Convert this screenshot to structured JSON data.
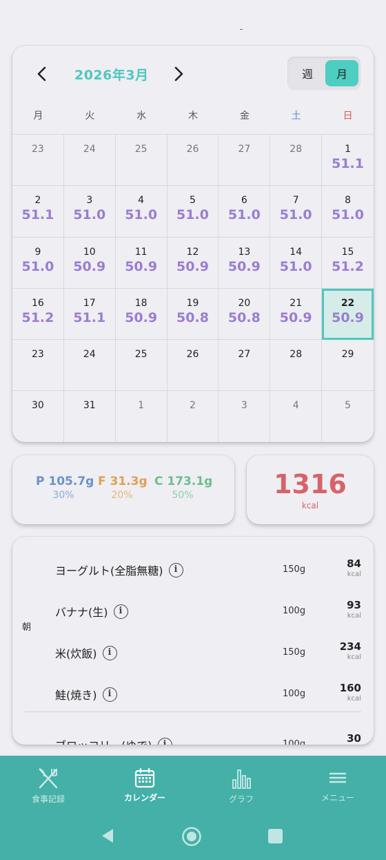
{
  "status": {
    "indicator": "-"
  },
  "calendar": {
    "title": "2026年3月",
    "toggle": {
      "week": "週",
      "month": "月",
      "selected": "月"
    },
    "weekdays": [
      "月",
      "火",
      "水",
      "木",
      "金",
      "土",
      "日"
    ],
    "today": "22",
    "cells": [
      {
        "day": "23",
        "weight": "",
        "other": true
      },
      {
        "day": "24",
        "weight": "",
        "other": true
      },
      {
        "day": "25",
        "weight": "",
        "other": true
      },
      {
        "day": "26",
        "weight": "",
        "other": true
      },
      {
        "day": "27",
        "weight": "",
        "other": true
      },
      {
        "day": "28",
        "weight": "",
        "other": true
      },
      {
        "day": "1",
        "weight": "51.1",
        "other": false
      },
      {
        "day": "2",
        "weight": "51.1",
        "other": false
      },
      {
        "day": "3",
        "weight": "51.0",
        "other": false
      },
      {
        "day": "4",
        "weight": "51.0",
        "other": false
      },
      {
        "day": "5",
        "weight": "51.0",
        "other": false
      },
      {
        "day": "6",
        "weight": "51.0",
        "other": false
      },
      {
        "day": "7",
        "weight": "51.0",
        "other": false
      },
      {
        "day": "8",
        "weight": "51.0",
        "other": false
      },
      {
        "day": "9",
        "weight": "51.0",
        "other": false
      },
      {
        "day": "10",
        "weight": "50.9",
        "other": false
      },
      {
        "day": "11",
        "weight": "50.9",
        "other": false
      },
      {
        "day": "12",
        "weight": "50.9",
        "other": false
      },
      {
        "day": "13",
        "weight": "50.9",
        "other": false
      },
      {
        "day": "14",
        "weight": "51.0",
        "other": false
      },
      {
        "day": "15",
        "weight": "51.2",
        "other": false
      },
      {
        "day": "16",
        "weight": "51.2",
        "other": false
      },
      {
        "day": "17",
        "weight": "51.1",
        "other": false
      },
      {
        "day": "18",
        "weight": "50.9",
        "other": false
      },
      {
        "day": "19",
        "weight": "50.8",
        "other": false
      },
      {
        "day": "20",
        "weight": "50.8",
        "other": false
      },
      {
        "day": "21",
        "weight": "50.9",
        "other": false
      },
      {
        "day": "22",
        "weight": "50.9",
        "other": false
      },
      {
        "day": "23",
        "weight": "",
        "other": false
      },
      {
        "day": "24",
        "weight": "",
        "other": false
      },
      {
        "day": "25",
        "weight": "",
        "other": false
      },
      {
        "day": "26",
        "weight": "",
        "other": false
      },
      {
        "day": "27",
        "weight": "",
        "other": false
      },
      {
        "day": "28",
        "weight": "",
        "other": false
      },
      {
        "day": "29",
        "weight": "",
        "other": false
      },
      {
        "day": "30",
        "weight": "",
        "other": false
      },
      {
        "day": "31",
        "weight": "",
        "other": false
      },
      {
        "day": "1",
        "weight": "",
        "other": true
      },
      {
        "day": "2",
        "weight": "",
        "other": true
      },
      {
        "day": "3",
        "weight": "",
        "other": true
      },
      {
        "day": "4",
        "weight": "",
        "other": true
      },
      {
        "day": "5",
        "weight": "",
        "other": true
      }
    ]
  },
  "macros": {
    "protein": {
      "value": "P 105.7g",
      "percent": "30%"
    },
    "fat": {
      "value": "F 31.3g",
      "percent": "20%"
    },
    "carb": {
      "value": "C 173.1g",
      "percent": "50%"
    }
  },
  "calories": {
    "value": "1316",
    "unit": "kcal"
  },
  "meals": {
    "breakfast_label": "朝",
    "info_glyph": "i",
    "items": [
      {
        "name": "ヨーグルト(全脂無糖)",
        "amount": "150g",
        "kcal": "84",
        "unit": "kcal"
      },
      {
        "name": "バナナ(生)",
        "amount": "100g",
        "kcal": "93",
        "unit": "kcal"
      },
      {
        "name": "米(炊飯)",
        "amount": "150g",
        "kcal": "234",
        "unit": "kcal"
      },
      {
        "name": "鮭(焼き)",
        "amount": "100g",
        "kcal": "160",
        "unit": "kcal"
      },
      {
        "name": "ブロッコリー(ゆで)",
        "amount": "100g",
        "kcal": "30",
        "unit": "kcal"
      }
    ]
  },
  "nav": {
    "items": [
      {
        "label": "食事記録",
        "icon": "fork-knife-icon"
      },
      {
        "label": "カレンダー",
        "icon": "calendar-icon"
      },
      {
        "label": "グラフ",
        "icon": "bar-chart-icon"
      },
      {
        "label": "メニュー",
        "icon": "menu-icon"
      }
    ],
    "active": 1
  },
  "colors": {
    "accent": "#4ec7bf",
    "weight": "#9b7dd0",
    "calories": "#d5646a",
    "navbar": "#44b0a8"
  }
}
